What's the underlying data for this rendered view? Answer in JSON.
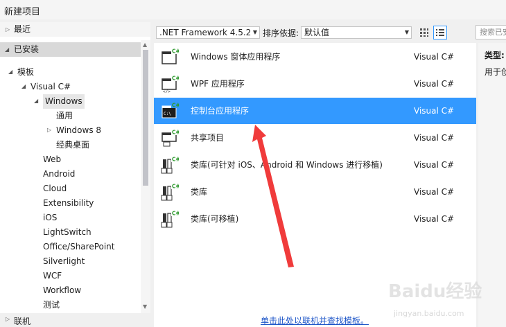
{
  "window": {
    "title": "新建项目"
  },
  "left_panel": {
    "recent": "最近",
    "installed": "已安装",
    "online": "联机",
    "tree": [
      {
        "label": "模板",
        "level": 0,
        "caret": "expanded"
      },
      {
        "label": "Visual C#",
        "level": 1,
        "caret": "expanded"
      },
      {
        "label": "Windows",
        "level": 2,
        "caret": "expanded",
        "selected": true
      },
      {
        "label": "通用",
        "level": 3,
        "caret": "none"
      },
      {
        "label": "Windows 8",
        "level": 3,
        "caret": "collapsed"
      },
      {
        "label": "经典桌面",
        "level": 3,
        "caret": "none"
      },
      {
        "label": "Web",
        "level": 2,
        "caret": "none"
      },
      {
        "label": "Android",
        "level": 2,
        "caret": "none"
      },
      {
        "label": "Cloud",
        "level": 2,
        "caret": "none"
      },
      {
        "label": "Extensibility",
        "level": 2,
        "caret": "none"
      },
      {
        "label": "iOS",
        "level": 2,
        "caret": "none"
      },
      {
        "label": "LightSwitch",
        "level": 2,
        "caret": "none"
      },
      {
        "label": "Office/SharePoint",
        "level": 2,
        "caret": "none"
      },
      {
        "label": "Silverlight",
        "level": 2,
        "caret": "none"
      },
      {
        "label": "WCF",
        "level": 2,
        "caret": "none"
      },
      {
        "label": "Workflow",
        "level": 2,
        "caret": "none"
      },
      {
        "label": "测试",
        "level": 2,
        "caret": "none"
      }
    ]
  },
  "toolbar": {
    "framework": ".NET Framework 4.5.2",
    "sort_label": "排序依据:",
    "sort_value": "默认值",
    "search_placeholder": "搜索已安装模板"
  },
  "templates": [
    {
      "name": "Windows 窗体应用程序",
      "lang": "Visual C#",
      "icon": "winforms-icon"
    },
    {
      "name": "WPF 应用程序",
      "lang": "Visual C#",
      "icon": "wpf-icon"
    },
    {
      "name": "控制台应用程序",
      "lang": "Visual C#",
      "icon": "console-icon",
      "selected": true
    },
    {
      "name": "共享项目",
      "lang": "Visual C#",
      "icon": "shared-project-icon"
    },
    {
      "name": "类库(可针对 iOS、Android 和 Windows 进行移植)",
      "lang": "Visual C#",
      "icon": "portable-library-icon"
    },
    {
      "name": "类库",
      "lang": "Visual C#",
      "icon": "class-library-icon"
    },
    {
      "name": "类库(可移植)",
      "lang": "Visual C#",
      "icon": "portable-class-library-icon"
    }
  ],
  "online_link": "单击此处以联机并查找模板。",
  "details": {
    "type_label": "类型:",
    "desc_prefix": "用于创"
  },
  "watermark": {
    "main": "Baidu经验",
    "sub": "jingyan.baidu.com"
  },
  "colors": {
    "selection": "#3399ff",
    "annotation_arrow": "#f03b3b",
    "link": "#1e56c8"
  }
}
